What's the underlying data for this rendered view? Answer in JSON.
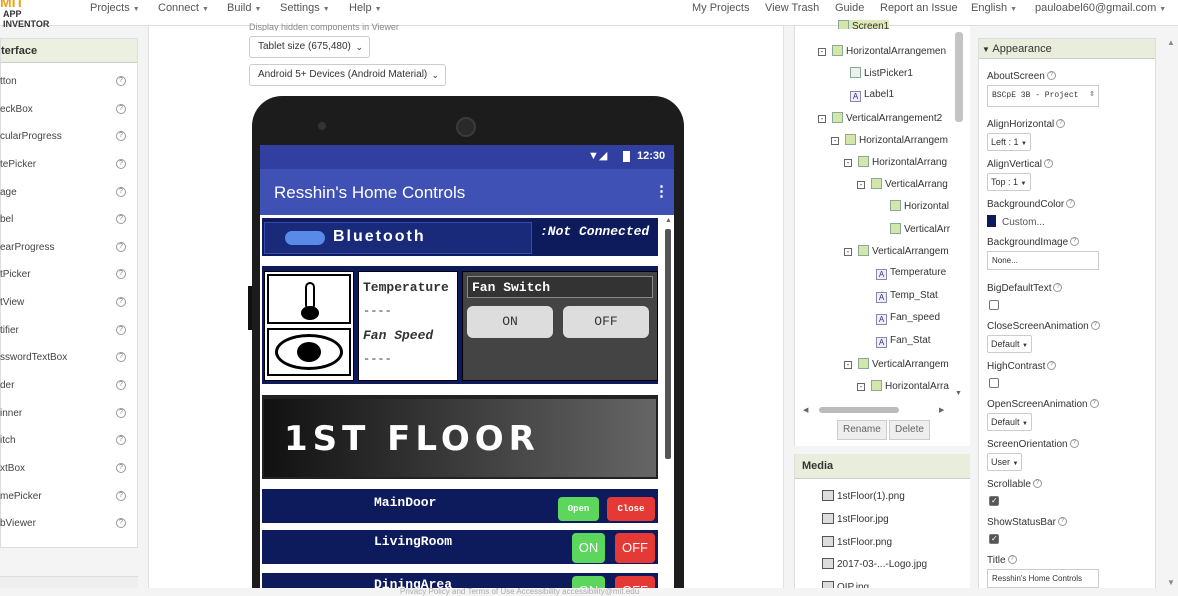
{
  "header": {
    "logo_top": "MIT",
    "logo_bottom": "APP INVENTOR",
    "menus": [
      "Projects",
      "Connect",
      "Build",
      "Settings",
      "Help"
    ],
    "right_links": [
      "My Projects",
      "View Trash",
      "Guide",
      "Report an Issue"
    ],
    "language": "English",
    "user_email": "pauloabel60@gmail.com"
  },
  "palette": {
    "heading": "terface",
    "items": [
      "tton",
      "eckBox",
      "cularProgress",
      "tePicker",
      "age",
      "bel",
      "earProgress",
      "tPicker",
      "tView",
      "tifier",
      "sswordTextBox",
      "der",
      "inner",
      "itch",
      "xtBox",
      "mePicker",
      "bViewer"
    ],
    "help_glyph": "?"
  },
  "viewer": {
    "hidden_components_label": "Display hidden components in Viewer",
    "size_select": "Tablet size (675,480)",
    "theme_select": "Android 5+ Devices (Android Material)"
  },
  "phone": {
    "status_time": "12:30",
    "app_title": "Resshin's Home Controls",
    "bluetooth_label": "Bluetooth",
    "connection_status": ":Not Connected",
    "temperature_label": "Temperature",
    "temperature_value": "----",
    "fan_speed_label": "Fan Speed",
    "fan_speed_value": "----",
    "fan_switch_label": "Fan Switch",
    "fan_on": "ON",
    "fan_off": "OFF",
    "floor_banner": "1ST FLOOR",
    "rooms": [
      {
        "name": "MainDoor",
        "btn_a": "Open",
        "btn_b": "Close"
      },
      {
        "name": "LivingRoom",
        "btn_a": "ON",
        "btn_b": "OFF"
      },
      {
        "name": "DiningArea",
        "btn_a": "ON",
        "btn_b": "OFF"
      }
    ]
  },
  "components_tree": {
    "rows": [
      "Screen1",
      "HorizontalArrangemen",
      "ListPicker1",
      "Label1",
      "VerticalArrangement2",
      "HorizontalArrangem",
      "HorizontalArrang",
      "VerticalArrang",
      "Horizontal",
      "VerticalArr",
      "VerticalArrangem",
      "Temperature",
      "Temp_Stat",
      "Fan_speed",
      "Fan_Stat",
      "VerticalArrangem",
      "HorizontalArra"
    ],
    "rename": "Rename",
    "delete": "Delete"
  },
  "media": {
    "heading": "Media",
    "files": [
      "1stFloor(1).png",
      "1stFloor.jpg",
      "1stFloor.png",
      "2017-03-...-Logo.jpg",
      "OIP.jpg"
    ]
  },
  "properties": {
    "section": "Appearance",
    "about_label": "AboutScreen",
    "about_value": "BSCpE 3B - Project",
    "align_h_label": "AlignHorizontal",
    "align_h_value": "Left : 1",
    "align_v_label": "AlignVertical",
    "align_v_value": "Top : 1",
    "bg_color_label": "BackgroundColor",
    "bg_color_value": "Custom...",
    "bg_image_label": "BackgroundImage",
    "bg_image_value": "None...",
    "big_text_label": "BigDefaultText",
    "close_anim_label": "CloseScreenAnimation",
    "close_anim_value": "Default",
    "high_contrast_label": "HighContrast",
    "open_anim_label": "OpenScreenAnimation",
    "open_anim_value": "Default",
    "orientation_label": "ScreenOrientation",
    "orientation_value": "User",
    "scrollable_label": "Scrollable",
    "status_bar_label": "ShowStatusBar",
    "title_label": "Title",
    "title_value": "Resshin's Home Controls"
  },
  "footer": {
    "text": "Privacy Policy and Terms of Use    Accessibility accessibility@mit.edu"
  },
  "colors": {
    "app_bar": "#3f51b5",
    "panel_navy": "#0d1a5c",
    "btn_green": "#5cd65c",
    "btn_red": "#e53935",
    "section_green": "#e8eddc"
  }
}
